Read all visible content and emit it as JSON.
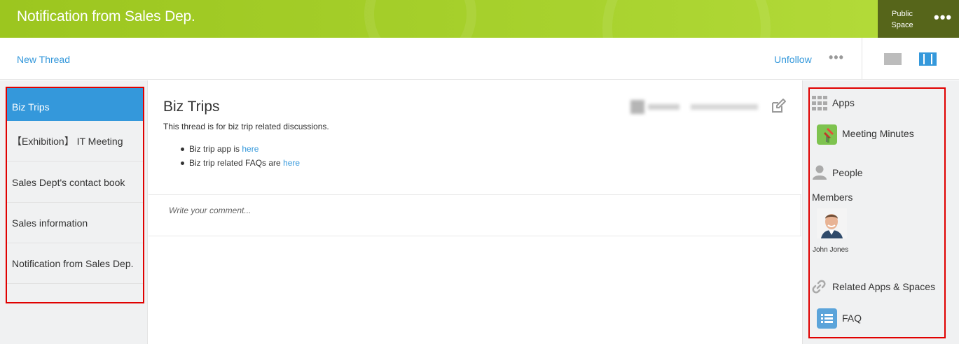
{
  "header": {
    "title": "Notification from Sales Dep.",
    "space_type": "Public Space",
    "menu_icon": "more-horizontal-icon"
  },
  "toolbar": {
    "new_thread": "New Thread",
    "unfollow": "Unfollow",
    "more_icon": "more-horizontal-icon",
    "view_single_icon": "single-pane-view-icon",
    "view_three_icon": "three-pane-view-icon"
  },
  "threads": [
    {
      "label": "Biz Trips",
      "active": true
    },
    {
      "label": "【Exhibition】 IT Meeting",
      "active": false
    },
    {
      "label": "Sales Dept's contact book",
      "active": false
    },
    {
      "label": "Sales information",
      "active": false
    },
    {
      "label": "Notification from Sales Dep.",
      "active": false
    }
  ],
  "thread": {
    "title": "Biz Trips",
    "description": "This thread is for biz trip related discussions.",
    "items": [
      {
        "text": "Biz trip app is ",
        "link": "here"
      },
      {
        "text": "Biz trip related FAQs are ",
        "link": "here"
      }
    ],
    "edit_icon": "edit-icon",
    "comment_placeholder": "Write your comment..."
  },
  "sidebar": {
    "apps_label": "Apps",
    "apps": [
      {
        "name": "Meeting Minutes",
        "icon": "meeting-minutes-app-icon",
        "color": "#7ec34f"
      },
      {
        "name": "FAQ",
        "icon": "faq-app-icon",
        "color": "#5ba4da"
      }
    ],
    "people_label": "People",
    "members_label": "Members",
    "members": [
      {
        "name": "John Jones"
      }
    ],
    "related_label": "Related Apps & Spaces"
  },
  "colors": {
    "header_green": "#a8d22e",
    "header_dark": "#56651a",
    "link_blue": "#3498db",
    "active_blue": "#3498db",
    "highlight_red": "#e00000"
  }
}
